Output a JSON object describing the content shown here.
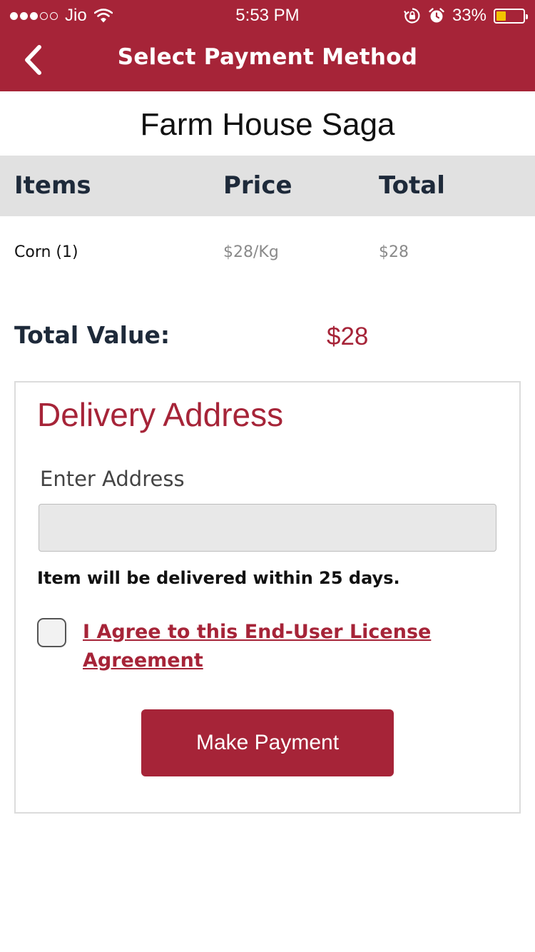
{
  "status_bar": {
    "carrier": "Jio",
    "time": "5:53 PM",
    "battery": "33%",
    "battery_level": 0.33,
    "icons": [
      "signal-dots-icon",
      "wifi-icon",
      "orientation-lock-icon",
      "alarm-icon",
      "battery-icon"
    ]
  },
  "nav": {
    "title": "Select Payment Method",
    "back_icon": "chevron-left-icon"
  },
  "store": {
    "name": "Farm House Saga"
  },
  "table": {
    "headers": [
      "Items",
      "Price",
      "Total"
    ],
    "rows": [
      {
        "item": "Corn (1)",
        "price": "$28/Kg",
        "total": "$28"
      }
    ]
  },
  "summary": {
    "label": "Total Value:",
    "value": "$28"
  },
  "delivery": {
    "title": "Delivery Address",
    "address_label": "Enter Address",
    "address_value": "",
    "address_placeholder": "",
    "note": "Item will be delivered within 25 days.",
    "agree_text": "I Agree to this End-User License Agreement",
    "agree_checked": false,
    "pay_button": "Make Payment"
  },
  "colors": {
    "brand": "#a62438",
    "header_bg": "#e1e1e1",
    "heading_text": "#1e2a3a",
    "battery_fill": "#f3c300"
  }
}
